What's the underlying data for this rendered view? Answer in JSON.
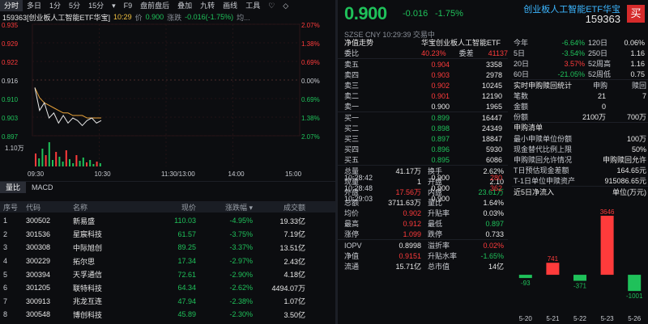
{
  "toolbar": {
    "items": [
      "分时",
      "多日",
      "1分",
      "5分",
      "15分",
      "▾",
      "F9",
      "盘前盘后",
      "叠加",
      "九转",
      "画线",
      "工具",
      "♡",
      "◇"
    ]
  },
  "info": {
    "code_name": "159363[创业板人工智能ETF华宝]",
    "time": "10:29",
    "price_label": "价",
    "price": "0.900",
    "chg_label": "涨跌",
    "chg": "-0.016(-1.75%)",
    "avg_label": "均..."
  },
  "chart": {
    "y_left": [
      "0.935",
      "0.929",
      "0.922",
      "0.916",
      "0.910",
      "0.903",
      "0.897"
    ],
    "y_right": [
      "2.07%",
      "1.38%",
      "0.69%",
      "0.00%",
      "0.69%",
      "1.38%",
      "2.07%"
    ],
    "vol_labels": [
      "1.10万",
      "1万"
    ],
    "x_labels": [
      "09:30",
      "10:30",
      "11:30/13:00",
      "14:00",
      "15:00"
    ],
    "price_line": [
      0.913,
      0.904,
      0.907,
      0.901,
      0.903,
      0.899,
      0.902,
      0.899,
      0.901,
      0.9,
      0.898,
      0.9,
      0.901,
      0.899,
      0.9
    ],
    "avg_line": [
      0.913,
      0.909,
      0.907,
      0.906,
      0.905,
      0.904,
      0.903,
      0.903,
      0.902,
      0.902,
      0.902,
      0.901,
      0.901,
      0.901,
      0.901
    ]
  },
  "subtabs": [
    "量比",
    "MACD"
  ],
  "table": {
    "headers": [
      "序号",
      "代码",
      "名称",
      "现价",
      "涨跌幅 ▾",
      "成交额"
    ],
    "rows": [
      [
        "1",
        "300502",
        "新易盛",
        "110.03",
        "-4.95%",
        "19.33亿"
      ],
      [
        "2",
        "301536",
        "星宸科技",
        "61.57",
        "-3.75%",
        "7.19亿"
      ],
      [
        "3",
        "300308",
        "中际旭创",
        "89.25",
        "-3.37%",
        "13.51亿"
      ],
      [
        "4",
        "300229",
        "拓尔思",
        "17.34",
        "-2.97%",
        "2.43亿"
      ],
      [
        "5",
        "300394",
        "天孚通信",
        "72.61",
        "-2.90%",
        "4.18亿"
      ],
      [
        "6",
        "301205",
        "联特科技",
        "64.34",
        "-2.62%",
        "4494.07万"
      ],
      [
        "7",
        "300913",
        "兆龙互连",
        "47.94",
        "-2.38%",
        "1.07亿"
      ],
      [
        "8",
        "300548",
        "博创科技",
        "45.89",
        "-2.30%",
        "3.50亿"
      ]
    ]
  },
  "header": {
    "price": "0.900",
    "chg": "-0.016",
    "chgp": "-1.75%",
    "name": "创业板人工智能ETF华宝",
    "code": "159363",
    "buy": "买"
  },
  "subinfo": "SZSE  CNY  10:29:39  交易中",
  "tabs_line": [
    "净值走势",
    "华宝创业板人工智能ETF"
  ],
  "weibi": {
    "label": "委比",
    "value": "40.23%",
    "label2": "委差",
    "value2": "41137"
  },
  "asks": [
    [
      "卖五",
      "0.904",
      "3358"
    ],
    [
      "卖四",
      "0.903",
      "2978"
    ],
    [
      "卖三",
      "0.902",
      "10245"
    ],
    [
      "卖二",
      "0.901",
      "12190"
    ],
    [
      "卖一",
      "0.900",
      "1965"
    ]
  ],
  "bids": [
    [
      "买一",
      "0.899",
      "16447"
    ],
    [
      "买二",
      "0.898",
      "24349"
    ],
    [
      "买三",
      "0.897",
      "18847"
    ],
    [
      "买四",
      "0.896",
      "5930"
    ],
    [
      "买五",
      "0.895",
      "6086"
    ]
  ],
  "summary": [
    [
      "总量",
      "41.17万",
      "换手",
      "2.62%"
    ],
    [
      "现量",
      "1",
      "开盘",
      "2.10"
    ],
    [
      "外盘",
      "17.56万",
      "内盘",
      "23.61万"
    ],
    [
      "总额",
      "3711.63万",
      "量比",
      "1.64%"
    ],
    [
      "均价",
      "0.902",
      "升贴率",
      "0.03%"
    ],
    [
      "最高",
      "0.912",
      "最低",
      "0.897"
    ],
    [
      "涨停",
      "1.099",
      "跌停",
      "0.733"
    ]
  ],
  "iopv": [
    [
      "IOPV",
      "0.8998",
      "溢折率",
      "0.02%"
    ],
    [
      "净值",
      "0.9151",
      "升贴水率",
      "-1.65%"
    ],
    [
      "流通",
      "15.71亿",
      "总市值",
      "14亿"
    ]
  ],
  "trades": [
    [
      "10:28:42",
      "0.900",
      "280"
    ],
    [
      "10:28:48",
      "0.900",
      "362"
    ],
    [
      "10:29:03",
      "0.900",
      ""
    ]
  ],
  "perf": [
    [
      "今年",
      "-6.64%",
      "120日",
      "0.06%"
    ],
    [
      "5日",
      "-3.54%",
      "250日",
      "1.16"
    ],
    [
      "20日",
      "3.57%",
      "52周高",
      "1.16"
    ],
    [
      "60日",
      "-21.05%",
      "52周低",
      "0.75"
    ]
  ],
  "realtime": {
    "title": "实时申购赎回统计",
    "c1": "申购",
    "c2": "赎回",
    "rows": [
      [
        "笔数",
        "21",
        "7"
      ],
      [
        "金额",
        "0",
        ""
      ],
      [
        "份额",
        "2100万",
        "700万"
      ]
    ]
  },
  "clearing": {
    "title": "申购清单",
    "rows": [
      [
        "最小申赎单位份额",
        "100万"
      ],
      [
        "现金替代比例上限",
        "50%"
      ],
      [
        "申购赎回允许情况",
        "申购赎回允许"
      ],
      [
        "T日预估现金差额",
        "164.65元"
      ],
      [
        "T-1日单位申赎资产",
        "915086.65元"
      ]
    ]
  },
  "flow": {
    "title": "近5日净流入",
    "unit": "单位(万元)"
  },
  "chart_data": {
    "type": "bar",
    "title": "近5日净流入",
    "ylabel": "单位(万元)",
    "categories": [
      "5-20",
      "5-21",
      "5-22",
      "5-23",
      "5-26"
    ],
    "values": [
      -93,
      741,
      -371,
      3646,
      -1001
    ]
  }
}
